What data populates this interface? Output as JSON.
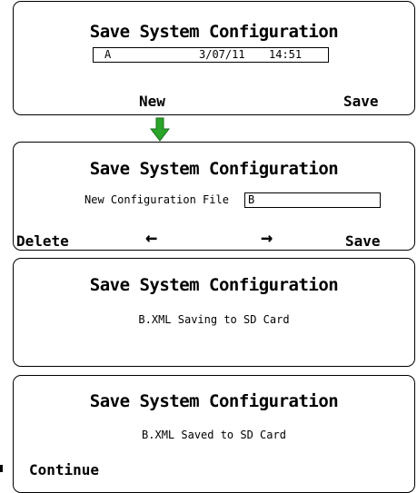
{
  "title": "Save System Configuration",
  "screen1": {
    "file_field": {
      "name": "A",
      "date": "3/07/11",
      "time": "14:51"
    },
    "softkeys": {
      "left": "New",
      "right": "Save"
    }
  },
  "transition_arrow": {
    "color": "#2aa52a",
    "icon": "down-arrow-icon"
  },
  "screen2": {
    "prompt": "New Configuration File",
    "input_value": "B",
    "softkeys": {
      "delete": "Delete",
      "left_arrow": "←",
      "right_arrow": "→",
      "save": "Save"
    }
  },
  "screen3": {
    "message": "B.XML Saving to SD Card"
  },
  "screen4": {
    "message": "B.XML Saved to SD Card",
    "softkeys": {
      "continue": "Continue"
    }
  }
}
